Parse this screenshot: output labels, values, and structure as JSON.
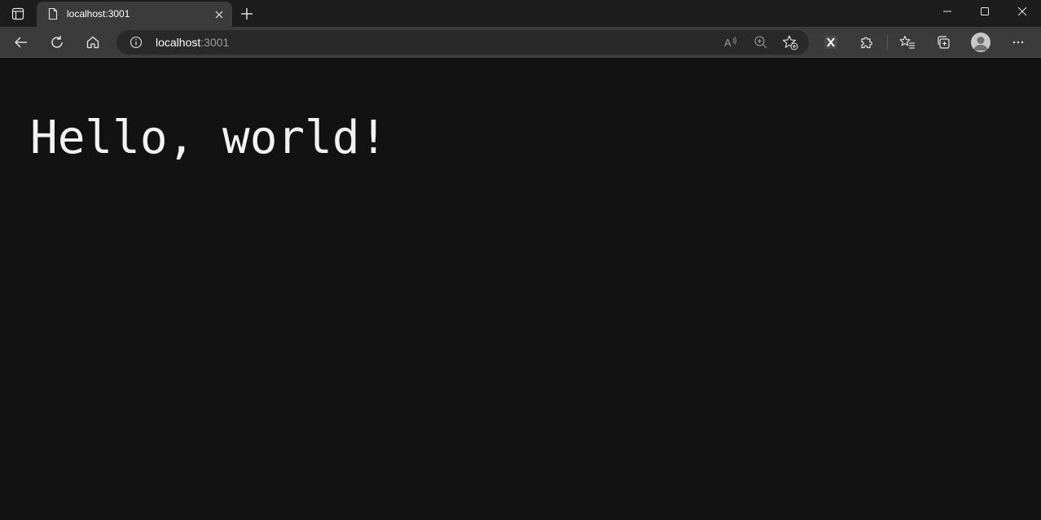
{
  "browser": {
    "tab": {
      "title": "localhost:3001"
    },
    "address_bar": {
      "host": "localhost",
      "port": ":3001"
    },
    "icons": {
      "tab_actions": "tab-actions-icon",
      "page": "page-icon",
      "close": "close-icon",
      "new_tab": "plus-icon",
      "back": "back-arrow-icon",
      "refresh": "refresh-icon",
      "home": "home-icon",
      "info": "info-icon",
      "read_aloud": "read-aloud-icon",
      "zoom": "zoom-in-icon",
      "favorite": "add-favorite-icon",
      "extension_x": "x-extension-icon",
      "extensions": "puzzle-icon",
      "favorites": "favorites-icon",
      "collections": "collections-icon",
      "profile": "avatar-icon",
      "more": "more-icon"
    }
  },
  "page": {
    "heading": "Hello, world!"
  },
  "colors": {
    "page_background": "#121212",
    "heading_text": "#f2f2f2",
    "toolbar": "#3b3b3b",
    "tabbar": "#1d1d1d"
  }
}
